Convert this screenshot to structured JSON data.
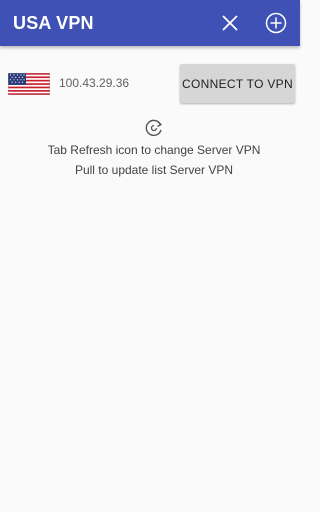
{
  "app_bar": {
    "title": "USA VPN",
    "background": "#3f51b5",
    "actions": [
      {
        "icon": "close-icon"
      },
      {
        "icon": "add-circle-icon"
      }
    ]
  },
  "server": {
    "flag_icon": "usa-flag-icon",
    "ip_address": "100.43.29.36",
    "connect_label": "CONNECT TO VPN"
  },
  "refresh": {
    "icon": "refresh-icon"
  },
  "hints": {
    "line1": "Tab Refresh icon to change Server VPN",
    "line2": "Pull to update list Server VPN"
  }
}
